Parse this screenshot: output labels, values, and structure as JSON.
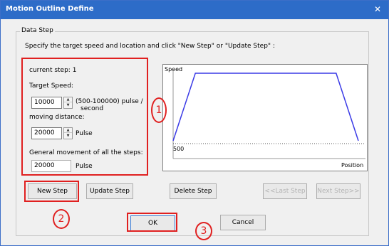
{
  "window": {
    "title": "Motion Outline Define",
    "close": "✕"
  },
  "group": {
    "legend": "Data Step",
    "instruction": "Specify the target speed and location and click \"New Step\" or \"Update Step\" :"
  },
  "params": {
    "current_step_label": "current step: 1",
    "target_speed_label": "Target Speed:",
    "target_speed_value": "10000",
    "target_speed_range": "(500-100000) pulse /",
    "target_speed_unit2": "second",
    "moving_distance_label": "moving distance:",
    "moving_distance_value": "20000",
    "moving_distance_unit": "Pulse",
    "general_movement_label": "General movement of all the steps:",
    "general_movement_value": "20000",
    "general_movement_unit": "Pulse"
  },
  "chart_data": {
    "type": "line",
    "ylabel": "Speed",
    "xlabel": "Position",
    "y_min_label": "500",
    "series": [
      {
        "points": [
          [
            0,
            500
          ],
          [
            0.12,
            10000
          ],
          [
            0.88,
            10000
          ],
          [
            1,
            500
          ]
        ]
      }
    ],
    "ylim": [
      0,
      10000
    ],
    "xlim": [
      0,
      1
    ],
    "colors": {
      "line": "#3a3ae6",
      "baseline": "#555555"
    }
  },
  "buttons": {
    "new_step": "New Step",
    "update_step": "Update Step",
    "delete_step": "Delete Step",
    "last_step": "<<Last Step",
    "next_step": "Next Step>>",
    "ok": "OK",
    "cancel": "Cancel"
  },
  "annotations": {
    "marker_1": "1",
    "marker_2": "2",
    "marker_3": "3",
    "color": "#e02020"
  }
}
